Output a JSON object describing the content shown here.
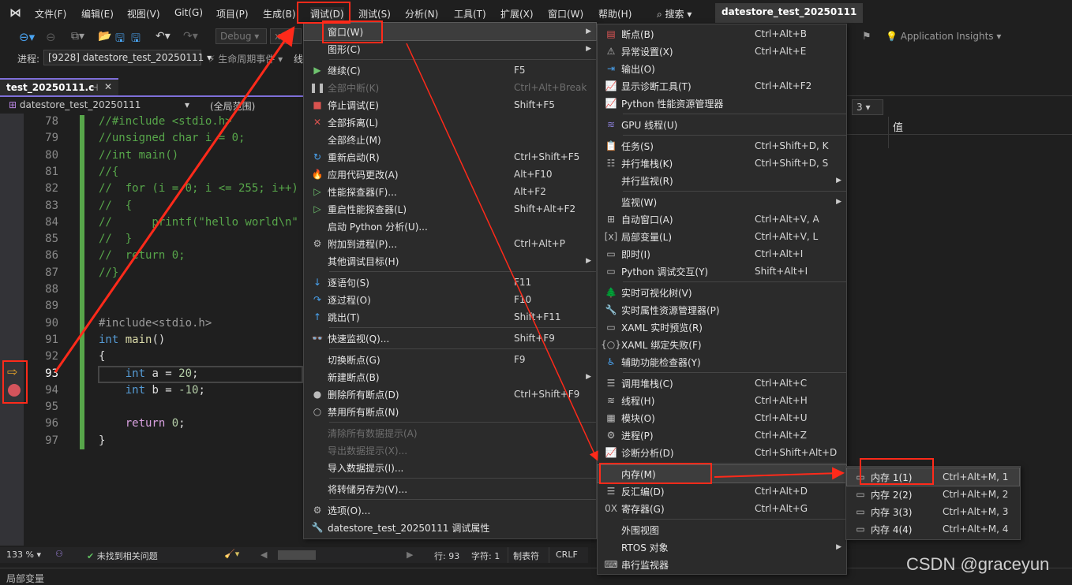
{
  "menubar": {
    "items": [
      "文件(F)",
      "编辑(E)",
      "视图(V)",
      "Git(G)",
      "项目(P)",
      "生成(B)",
      "调试(D)",
      "测试(S)",
      "分析(N)",
      "工具(T)",
      "扩展(X)",
      "窗口(W)",
      "帮助(H)"
    ],
    "search": "搜索",
    "solution_title": "datestore_test_20250111"
  },
  "toolbar": {
    "config": "Debug",
    "platform": "x64",
    "process_label": "进程:",
    "process": "[9228] datestore_test_20250111",
    "lifecycle": "生命周期事件",
    "thread_label": "线",
    "app_insights": "Application Insights",
    "frame_value": "3"
  },
  "editor": {
    "tab": "test_20250111.c",
    "project_scope": "datestore_test_20250111",
    "scope": "(全局范围)",
    "zoom": "133 %",
    "issues": "未找到相关问题",
    "line": "行: 93",
    "char": "字符: 1",
    "tabs": "制表符",
    "eol": "CRLF",
    "lines": [
      {
        "n": "78",
        "t": [
          [
            "//#include <stdio.h>",
            "cm"
          ]
        ]
      },
      {
        "n": "79",
        "t": [
          [
            "//unsigned char i = 0;",
            "cm"
          ]
        ]
      },
      {
        "n": "80",
        "t": [
          [
            "//int main()",
            "cm"
          ]
        ]
      },
      {
        "n": "81",
        "t": [
          [
            "//{",
            "cm"
          ]
        ]
      },
      {
        "n": "82",
        "t": [
          [
            "//  for (i = 0; i <= 255; i++)",
            "cm"
          ]
        ]
      },
      {
        "n": "83",
        "t": [
          [
            "//  {",
            "cm"
          ]
        ]
      },
      {
        "n": "84",
        "t": [
          [
            "//      printf(\"hello world\\n\"",
            "cm"
          ]
        ]
      },
      {
        "n": "85",
        "t": [
          [
            "//  }",
            "cm"
          ]
        ]
      },
      {
        "n": "86",
        "t": [
          [
            "//  return 0;",
            "cm"
          ]
        ]
      },
      {
        "n": "87",
        "t": [
          [
            "//}",
            "cm"
          ]
        ]
      },
      {
        "n": "88",
        "t": []
      },
      {
        "n": "89",
        "t": []
      },
      {
        "n": "90",
        "t": [
          [
            "#include<stdio.h>",
            "pp"
          ]
        ]
      },
      {
        "n": "91",
        "t": [
          [
            "int ",
            "kw"
          ],
          [
            "main",
            "fn"
          ],
          [
            "()",
            "tx"
          ]
        ]
      },
      {
        "n": "92",
        "t": [
          [
            "{",
            "tx"
          ]
        ]
      },
      {
        "n": "93",
        "t": [
          [
            "    int ",
            "kw"
          ],
          [
            "a",
            "tx"
          ],
          [
            " = ",
            "tx"
          ],
          [
            "20",
            "num"
          ],
          [
            ";",
            "tx"
          ]
        ]
      },
      {
        "n": "94",
        "t": [
          [
            "    int ",
            "kw"
          ],
          [
            "b",
            "tx"
          ],
          [
            " = ",
            "tx"
          ],
          [
            "-10",
            "num"
          ],
          [
            ";",
            "tx"
          ]
        ]
      },
      {
        "n": "95",
        "t": []
      },
      {
        "n": "96",
        "t": [
          [
            "    return ",
            "rt"
          ],
          [
            "0",
            "num"
          ],
          [
            ";",
            "tx"
          ]
        ]
      },
      {
        "n": "97",
        "t": [
          [
            "}",
            "tx"
          ]
        ]
      }
    ]
  },
  "watch": {
    "value_header": "值"
  },
  "bottom_panel": {
    "title": "局部变量"
  },
  "debug_menu": [
    {
      "l": "窗口(W)",
      "i": "",
      "sub": true,
      "hl": true
    },
    {
      "l": "图形(C)",
      "i": "",
      "sub": true
    },
    {
      "sep": true
    },
    {
      "l": "继续(C)",
      "s": "F5",
      "i": "▶",
      "c": "#6fc46f"
    },
    {
      "l": "全部中断(K)",
      "s": "Ctrl+Alt+Break",
      "i": "❚❚",
      "dis": true
    },
    {
      "l": "停止调试(E)",
      "s": "Shift+F5",
      "i": "■",
      "c": "#d9534f"
    },
    {
      "l": "全部拆离(L)",
      "i": "✕",
      "c": "#d9534f"
    },
    {
      "l": "全部终止(M)",
      "i": ""
    },
    {
      "l": "重新启动(R)",
      "s": "Ctrl+Shift+F5",
      "i": "↻",
      "c": "#4aa3f0"
    },
    {
      "l": "应用代码更改(A)",
      "s": "Alt+F10",
      "i": "🔥",
      "c": "#e0554d"
    },
    {
      "l": "性能探查器(F)...",
      "s": "Alt+F2",
      "i": "▷",
      "c": "#6fc46f"
    },
    {
      "l": "重启性能探查器(L)",
      "s": "Shift+Alt+F2",
      "i": "▷",
      "c": "#6fc46f"
    },
    {
      "l": "启动 Python 分析(U)...",
      "i": ""
    },
    {
      "l": "附加到进程(P)...",
      "s": "Ctrl+Alt+P",
      "i": "⚙"
    },
    {
      "l": "其他调试目标(H)",
      "i": "",
      "sub": true
    },
    {
      "sep": true
    },
    {
      "l": "逐语句(S)",
      "s": "F11",
      "i": "↓",
      "c": "#4aa3f0"
    },
    {
      "l": "逐过程(O)",
      "s": "F10",
      "i": "↷",
      "c": "#4aa3f0"
    },
    {
      "l": "跳出(T)",
      "s": "Shift+F11",
      "i": "↑",
      "c": "#4aa3f0"
    },
    {
      "sep": true
    },
    {
      "l": "快速监视(Q)...",
      "s": "Shift+F9",
      "i": "👓"
    },
    {
      "sep": true
    },
    {
      "l": "切换断点(G)",
      "s": "F9",
      "i": ""
    },
    {
      "l": "新建断点(B)",
      "i": "",
      "sub": true
    },
    {
      "l": "删除所有断点(D)",
      "s": "Ctrl+Shift+F9",
      "i": "●"
    },
    {
      "l": "禁用所有断点(N)",
      "i": "○"
    },
    {
      "sep": true
    },
    {
      "l": "清除所有数据提示(A)",
      "i": "",
      "dis": true
    },
    {
      "l": "导出数据提示(X)...",
      "i": "",
      "dis": true
    },
    {
      "l": "导入数据提示(I)...",
      "i": ""
    },
    {
      "sep": true
    },
    {
      "l": "将转储另存为(V)...",
      "i": ""
    },
    {
      "sep": true
    },
    {
      "l": "选项(O)...",
      "i": "⚙"
    },
    {
      "l": "datestore_test_20250111 调试属性",
      "i": "🔧"
    }
  ],
  "window_menu": [
    {
      "l": "断点(B)",
      "s": "Ctrl+Alt+B",
      "i": "▤",
      "c": "#e05555"
    },
    {
      "l": "异常设置(X)",
      "s": "Ctrl+Alt+E",
      "i": "⚠"
    },
    {
      "l": "输出(O)",
      "i": "⇥",
      "c": "#4aa3f0"
    },
    {
      "l": "显示诊断工具(T)",
      "s": "Ctrl+Alt+F2",
      "i": "📈",
      "c": "#6fc46f"
    },
    {
      "l": "Python 性能资源管理器",
      "i": "📈",
      "c": "#6fc46f"
    },
    {
      "sep": true
    },
    {
      "l": "GPU 线程(U)",
      "i": "≋",
      "c": "#8a7fd8"
    },
    {
      "sep": true
    },
    {
      "l": "任务(S)",
      "s": "Ctrl+Shift+D, K",
      "i": "📋"
    },
    {
      "l": "并行堆栈(K)",
      "s": "Ctrl+Shift+D, S",
      "i": "☷"
    },
    {
      "l": "并行监视(R)",
      "i": "",
      "sub": true
    },
    {
      "sep": true
    },
    {
      "l": "监视(W)",
      "i": "",
      "sub": true
    },
    {
      "l": "自动窗口(A)",
      "s": "Ctrl+Alt+V, A",
      "i": "⊞"
    },
    {
      "l": "局部变量(L)",
      "s": "Ctrl+Alt+V, L",
      "i": "[x]"
    },
    {
      "l": "即时(I)",
      "s": "Ctrl+Alt+I",
      "i": "▭"
    },
    {
      "l": "Python 调试交互(Y)",
      "s": "Shift+Alt+I",
      "i": "▭"
    },
    {
      "sep": true
    },
    {
      "l": "实时可视化树(V)",
      "i": "🌲"
    },
    {
      "l": "实时属性资源管理器(P)",
      "i": "🔧"
    },
    {
      "l": "XAML 实时预览(R)",
      "i": "▭"
    },
    {
      "l": "XAML 绑定失败(F)",
      "i": "{○}"
    },
    {
      "l": "辅助功能检查器(Y)",
      "i": "♿",
      "c": "#4aa3f0"
    },
    {
      "sep": true
    },
    {
      "l": "调用堆栈(C)",
      "s": "Ctrl+Alt+C",
      "i": "☰"
    },
    {
      "l": "线程(H)",
      "s": "Ctrl+Alt+H",
      "i": "≋"
    },
    {
      "l": "模块(O)",
      "s": "Ctrl+Alt+U",
      "i": "▦"
    },
    {
      "l": "进程(P)",
      "s": "Ctrl+Alt+Z",
      "i": "⚙"
    },
    {
      "l": "诊断分析(D)",
      "s": "Ctrl+Shift+Alt+D",
      "i": "📈",
      "c": "#4aa3f0"
    },
    {
      "sep": true
    },
    {
      "l": "内存(M)",
      "i": "",
      "sub": true,
      "hl": true
    },
    {
      "l": "反汇编(D)",
      "s": "Ctrl+Alt+D",
      "i": "☰"
    },
    {
      "l": "寄存器(G)",
      "s": "Ctrl+Alt+G",
      "i": "0X"
    },
    {
      "sep": true
    },
    {
      "l": "外围视图",
      "i": ""
    },
    {
      "l": "RTOS 对象",
      "i": "",
      "sub": true
    },
    {
      "l": "串行监视器",
      "i": "⌨"
    }
  ],
  "memory_menu": [
    {
      "l": "内存 1(1)",
      "s": "Ctrl+Alt+M, 1",
      "i": "▭",
      "hl": true
    },
    {
      "l": "内存 2(2)",
      "s": "Ctrl+Alt+M, 2",
      "i": "▭"
    },
    {
      "l": "内存 3(3)",
      "s": "Ctrl+Alt+M, 3",
      "i": "▭"
    },
    {
      "l": "内存 4(4)",
      "s": "Ctrl+Alt+M, 4",
      "i": "▭"
    }
  ],
  "watermark": "CSDN @graceyun",
  "colors": {
    "annotation": "#ff2a1a",
    "change_bar": "#57a64a",
    "breakpoint": "#d4545c"
  }
}
